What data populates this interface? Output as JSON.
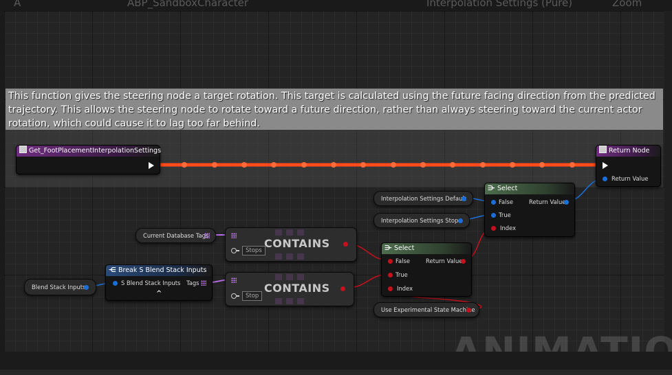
{
  "topbar": {
    "ghost_text": [
      "A",
      "ABP_SandboxCharacter",
      "Interpolation Settings (Pure)",
      "Zoom"
    ]
  },
  "comment": {
    "text": "This function gives the steering node a target rotation. This target is calculated using the future facing direction from the predicted trajectory. This allows the steering node to rotate toward a future direction, rather than always steering toward the current actor rotation, which could cause it to lag too far behind."
  },
  "nodes": {
    "function_entry": {
      "title": "Get_FootPlacementInterpolationSettings"
    },
    "return_node": {
      "title": "Return Node",
      "pin_return_value": "Return Value"
    },
    "select_top": {
      "title": "Select",
      "pin_false": "False",
      "pin_true": "True",
      "pin_index": "Index",
      "pin_return_value": "Return Value"
    },
    "select_bottom": {
      "title": "Select",
      "pin_false": "False",
      "pin_true": "True",
      "pin_index": "Index",
      "pin_return_value": "Return Value"
    },
    "interp_default": {
      "label": "Interpolation Settings Default"
    },
    "interp_stops": {
      "label": "Interpolation Settings Stops"
    },
    "current_db_tags": {
      "label": "Current Database Tags"
    },
    "contains_top": {
      "title": "CONTAINS",
      "value": "Stops"
    },
    "contains_bottom": {
      "title": "CONTAINS",
      "value": "Stop"
    },
    "break_blend": {
      "title": "Break S Blend Stack Inputs",
      "pin_in": "S Blend Stack Inputs",
      "pin_tags": "Tags",
      "expand_glyph": "^"
    },
    "blend_stack_inputs": {
      "label": "Blend Stack Inputs"
    },
    "use_experimental": {
      "label": "Use Experimental State Machine"
    }
  },
  "watermark": {
    "text": "ANIMATION"
  },
  "colors": {
    "exec_wire": "#ff4a1a",
    "struct_wire": "#1a6fd8",
    "bool_wire": "#c5101d",
    "array_wire": "#b86ee8",
    "function_header": "#6e2d7e",
    "select_header": "#4d6d4d",
    "break_header": "#2a4a78"
  }
}
